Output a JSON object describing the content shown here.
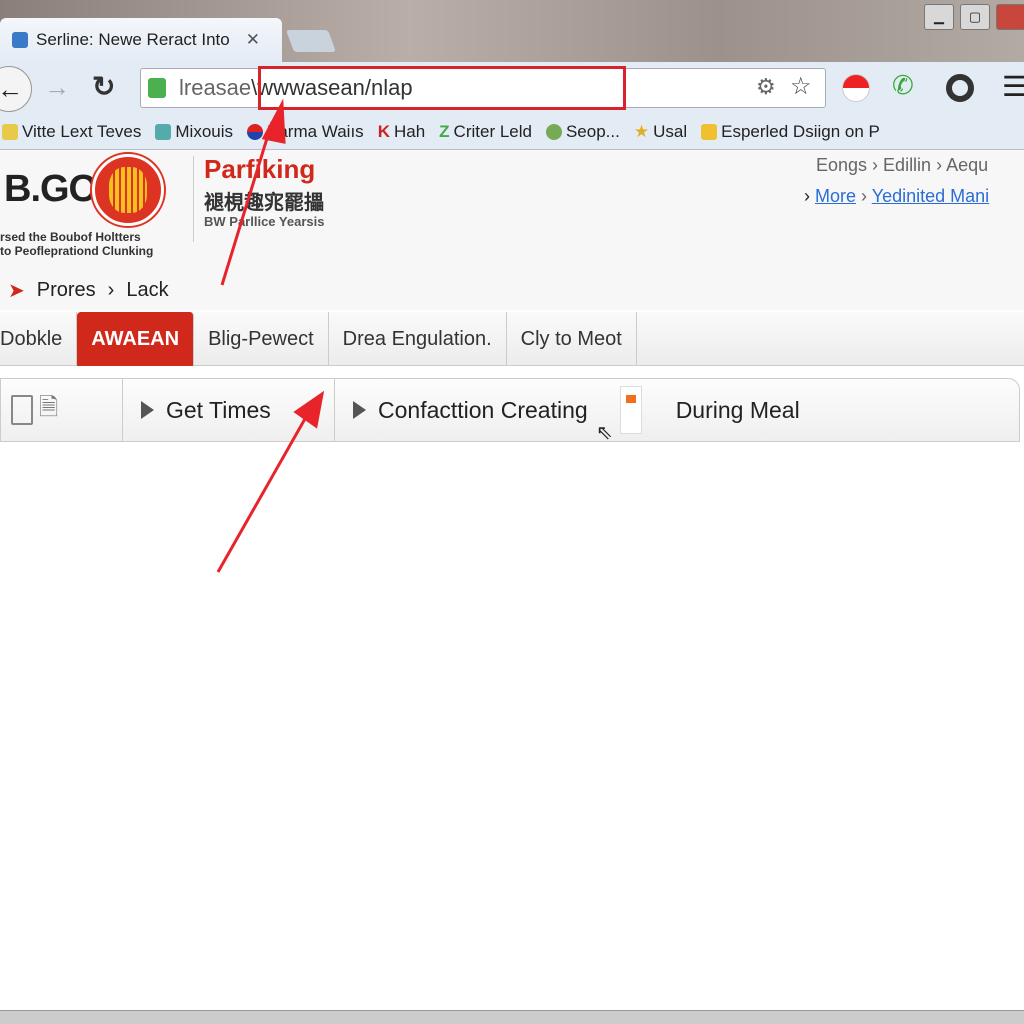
{
  "browser": {
    "tab_title": "Serline: Newe Reract Into",
    "address_prefix": "lreasae",
    "address_url": "\\wwwasean/nlap",
    "bookmarks": [
      "Vitte Lext Teves",
      "Mixouis",
      "Xarma Waiıs",
      "Hah",
      "Criter Leld",
      "Seop...",
      "Usal",
      "Esperled Dsiign on P"
    ]
  },
  "header": {
    "logo_text": "B.GO",
    "logo_sub1": "rsed the Boubof Holtters",
    "logo_sub2": "to Peofleprationd Clunking",
    "brand": "Parfiking",
    "brand_cjk": "褪梘趣宨罷攂",
    "brand_sub": "BW Parllice Yearsis",
    "top_links": [
      "Eongs",
      "Edillin",
      "Aequ"
    ],
    "links": [
      "More",
      "Yedinited Mani"
    ],
    "breadcrumb": [
      "Prores",
      "Lack"
    ]
  },
  "nav": {
    "tabs": [
      "Dobkle",
      "AWAEAN",
      "Blig-Pewect",
      "Drea Engulation.",
      "Cly to Meot"
    ],
    "active": 1
  },
  "subbar": {
    "items": [
      "Get Times",
      "Confacttion Creating",
      "During Meal"
    ]
  },
  "colors": {
    "accent": "#d0281b",
    "annotation": "#e8232a",
    "link": "#2b6dd6"
  }
}
